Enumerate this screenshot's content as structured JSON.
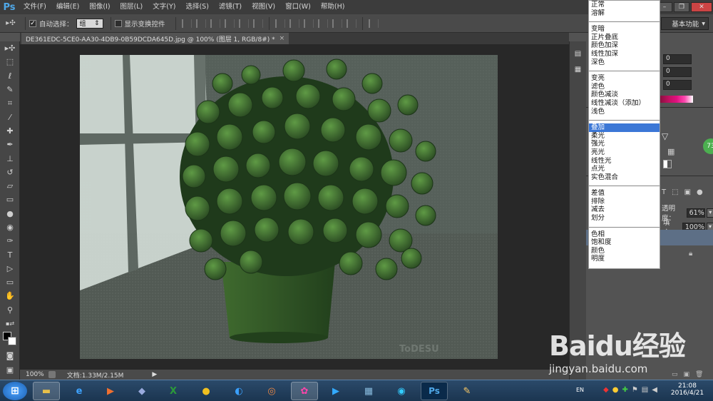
{
  "app": {
    "logo": "Ps"
  },
  "menu": [
    "文件(F)",
    "编辑(E)",
    "图像(I)",
    "图层(L)",
    "文字(Y)",
    "选择(S)",
    "滤镜(T)",
    "视图(V)",
    "窗口(W)",
    "帮助(H)"
  ],
  "options_bar": {
    "auto_select_label": "自动选择：",
    "auto_select_value": "组",
    "show_transform_label": "显示变换控件",
    "workspace_label": "基本功能"
  },
  "document": {
    "tab_title": "DE361EDC-5CE0-AA30-4DB9-0B59DCDA645D.jpg @ 100% (图层 1, RGB/8#) *",
    "watermark": "ToDESU"
  },
  "status": {
    "zoom": "100%",
    "doc_size": "文档:1.33M/2.15M"
  },
  "blend_modes": {
    "groups": [
      [
        "正常",
        "溶解"
      ],
      [
        "变暗",
        "正片叠底",
        "颜色加深",
        "线性加深",
        "深色"
      ],
      [
        "变亮",
        "滤色",
        "颜色减淡",
        "线性减淡（添加）",
        "浅色"
      ],
      [
        "叠加",
        "柔光",
        "强光",
        "亮光",
        "线性光",
        "点光",
        "实色混合"
      ],
      [
        "差值",
        "排除",
        "减去",
        "划分"
      ],
      [
        "色相",
        "饱和度",
        "颜色",
        "明度"
      ]
    ],
    "selected": "叠加"
  },
  "right_panel": {
    "field_values": [
      "0",
      "0",
      "0"
    ],
    "opacity_label": "不透明度：",
    "opacity_label_visible": "透明度：",
    "opacity_value": "61%",
    "fill_label": "填充：",
    "fill_value": "100%",
    "badge": "73"
  },
  "taskbar": {
    "time": "21:08",
    "date": "2016/4/21",
    "lang": "EN"
  },
  "overlay_watermark": {
    "brand": "Baidu经验",
    "url": "jingyan.baidu.com"
  },
  "colors": {
    "menubar": "#3c3c3c",
    "panel": "#535353",
    "selection": "#3b77d6",
    "ps_blue": "#4fa8e8"
  }
}
